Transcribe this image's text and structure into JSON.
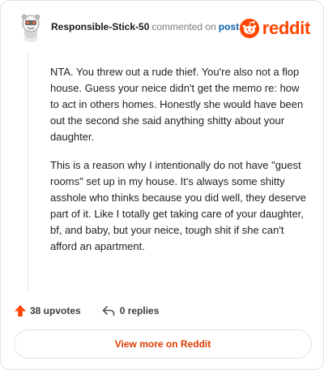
{
  "comment": {
    "username": "Responsible-Stick-50",
    "action_text": "commented on",
    "post_link": "post",
    "brand": "reddit",
    "paragraphs": [
      "NTA. You threw out a rude thief. You're also not a flop house. Guess your neice didn't get the memo re: how to act in others homes. Honestly she would have been out the second she said anything shitty about your daughter.",
      "This is a reason why I intentionally do not have \"guest rooms\" set up in my house. It's always some shitty asshole who thinks because you did well, they deserve part of it. Like I totally get taking care of your daughter, bf, and baby, but your neice, tough shit if she can't afford an apartment."
    ],
    "upvotes": "38 upvotes",
    "replies": "0 replies",
    "view_button": "View more on Reddit"
  },
  "colors": {
    "brand": "#ff4500",
    "upvote": "#ff4500",
    "link": "#0b5fa8",
    "view_button_text": "#d93a00"
  },
  "icons": {
    "avatar": "reddit-snoo-avatar",
    "logo": "reddit-logo-icon",
    "upvote": "upvote-arrow-icon",
    "reply": "reply-arrow-icon"
  }
}
